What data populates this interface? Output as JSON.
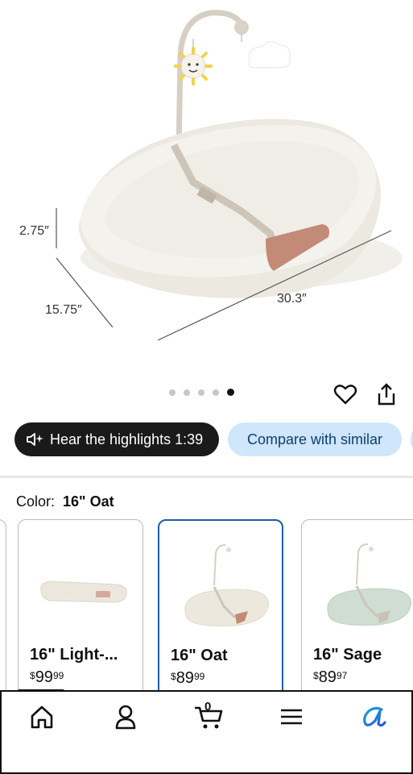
{
  "product": {
    "dimensions": {
      "height": "2.75″",
      "width": "15.75″",
      "length": "30.3″"
    },
    "gallery": {
      "count": 5,
      "active_index": 4
    }
  },
  "actions": {
    "highlights_label": "Hear the highlights 1:39",
    "compare_label": "Compare with similar"
  },
  "color_selector": {
    "label": "Color:",
    "selected": "16\" Oat",
    "options": [
      {
        "name": "16\" Light-...",
        "currency": "$",
        "dollars": "99",
        "cents": "99",
        "swatch": "#ece7dd"
      },
      {
        "name": "16\" Oat",
        "currency": "$",
        "dollars": "89",
        "cents": "99",
        "swatch": "#ece8de"
      },
      {
        "name": "16\" Sage",
        "currency": "$",
        "dollars": "89",
        "cents": "97",
        "swatch": "#cfddd2"
      }
    ]
  },
  "nav": {
    "cart_count": "0",
    "items": [
      "home-icon",
      "account-icon",
      "cart-icon",
      "menu-icon",
      "assistant-icon"
    ]
  },
  "colors": {
    "accent_blue": "#1a5ea8",
    "pill_light": "#cfe6fb",
    "dark": "#1a1a1a",
    "clay": "#c48a78"
  }
}
